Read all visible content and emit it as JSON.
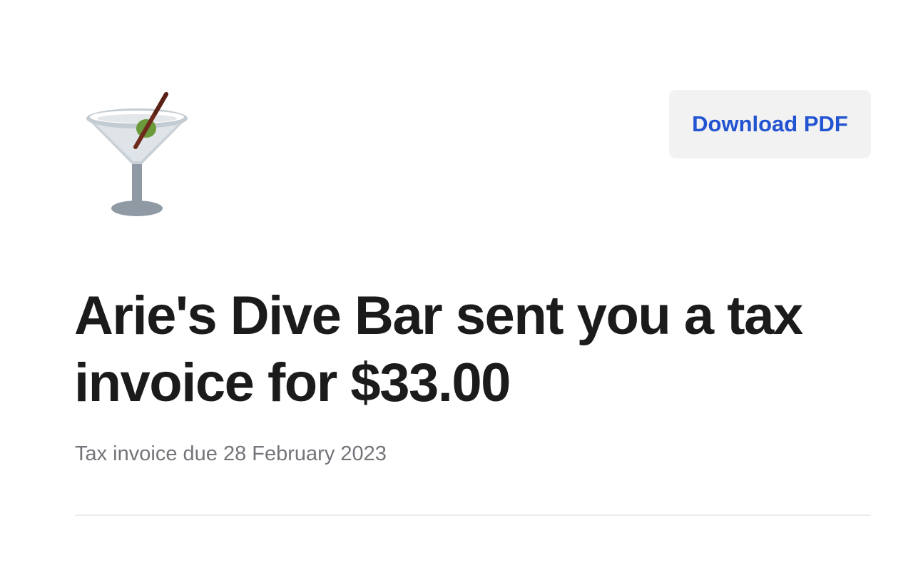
{
  "header": {
    "logo_icon": "martini-glass-icon",
    "download_label": "Download PDF"
  },
  "invoice": {
    "headline": "Arie's Dive Bar sent you a tax invoice for $33.00",
    "due_text": "Tax invoice due 28 February 2023"
  },
  "colors": {
    "button_text": "#2254d1",
    "button_bg": "#f2f2f2",
    "headline": "#1b1b1b",
    "subtext": "#74747a"
  }
}
